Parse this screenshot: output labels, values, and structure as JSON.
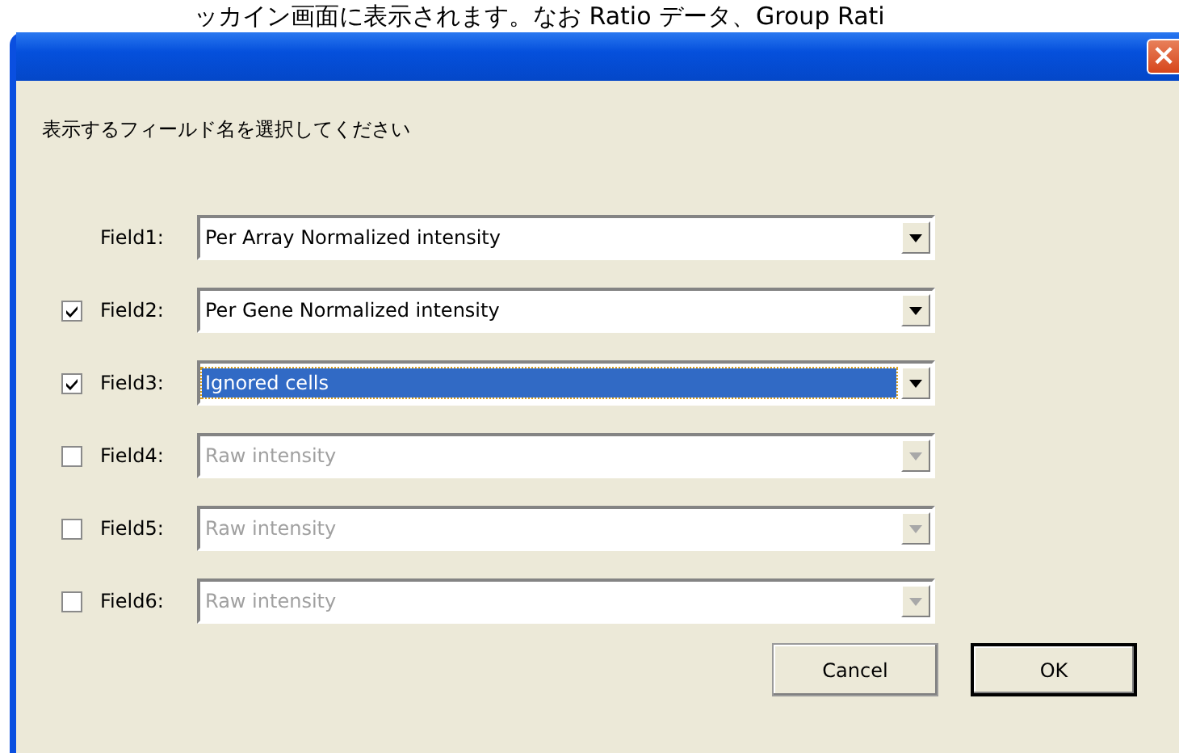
{
  "caption": "ッカイン画面に表示されます。なお Ratio データ、Group Rati",
  "window": {
    "close": "×"
  },
  "prompt": "表示するフィールド名を選択してください",
  "fields": [
    {
      "kind": "plain",
      "label": "Field1:",
      "value": "Per Array Normalized intensity",
      "disabled": false,
      "focused": false
    },
    {
      "kind": "checkbox",
      "checked": true,
      "label": "Field2:",
      "value": "Per Gene Normalized intensity",
      "disabled": false,
      "focused": false
    },
    {
      "kind": "checkbox",
      "checked": true,
      "label": "Field3:",
      "value": "Ignored cells",
      "disabled": false,
      "focused": true
    },
    {
      "kind": "checkbox",
      "checked": false,
      "label": "Field4:",
      "value": "Raw intensity",
      "disabled": true,
      "focused": false
    },
    {
      "kind": "checkbox",
      "checked": false,
      "label": "Field5:",
      "value": "Raw intensity",
      "disabled": true,
      "focused": false
    },
    {
      "kind": "checkbox",
      "checked": false,
      "label": "Field6:",
      "value": "Raw intensity",
      "disabled": true,
      "focused": false
    }
  ],
  "buttons": [
    {
      "label": "Cancel",
      "default": false
    },
    {
      "label": "OK",
      "default": true
    }
  ]
}
